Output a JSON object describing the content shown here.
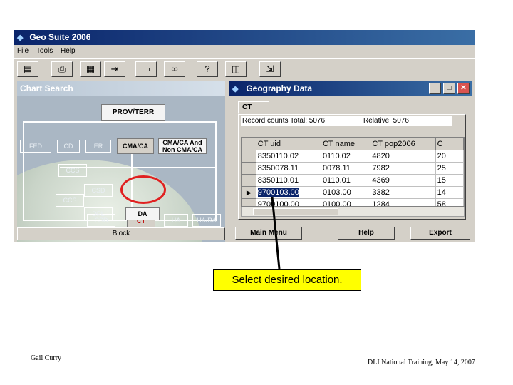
{
  "app": {
    "title": "Geo Suite 2006",
    "menu": [
      "File",
      "Tools",
      "Help"
    ],
    "toolbar_icons": [
      "form-icon",
      "print-icon",
      "calculator-icon",
      "export-icon",
      "window-icon",
      "binoculars-icon",
      "help-pointer-icon",
      "book-icon",
      "exit-icon"
    ]
  },
  "chart_search": {
    "title": "Chart Search",
    "boxes": {
      "prov_terr": "PROV/TERR",
      "fed": "FED",
      "cd": "CD",
      "er": "ER",
      "cma_ca": "CMA/CA",
      "cma_ca_and_non": "CMA/CA And Non CMA/CA",
      "ccs": "CCS",
      "csd": "CSD",
      "ct": "CT",
      "ua": "UA",
      "ua_ra": "UA/RA",
      "dpl": "DPL",
      "da": "DA"
    },
    "block": "Block"
  },
  "geography": {
    "title": "Geography Data",
    "tab": "CT",
    "record_total": "Record counts Total: 5076",
    "relative": "Relative: 5076",
    "columns": [
      "CT uid",
      "CT name",
      "CT pop2006",
      "C"
    ],
    "rows": [
      {
        "indicator": "",
        "uid": "8350110.02",
        "name": "0110.02",
        "pop": "4820",
        "c": "20"
      },
      {
        "indicator": "",
        "uid": "8350078.11",
        "name": "0078.11",
        "pop": "7982",
        "c": "25"
      },
      {
        "indicator": "",
        "uid": "8350110.01",
        "name": "0110.01",
        "pop": "4369",
        "c": "15"
      },
      {
        "indicator": "▶",
        "uid": "9700103.00",
        "name": "0103.00",
        "pop": "3382",
        "c": "14"
      },
      {
        "indicator": "",
        "uid": "9700100.00",
        "name": "0100.00",
        "pop": "1284",
        "c": "58"
      }
    ],
    "buttons": {
      "main_menu": "Main Menu",
      "help": "Help",
      "export": "Export"
    }
  },
  "callout": "Select desired location.",
  "footer": {
    "author": "Gail Curry",
    "event": "DLI National Training, May 14, 2007"
  }
}
